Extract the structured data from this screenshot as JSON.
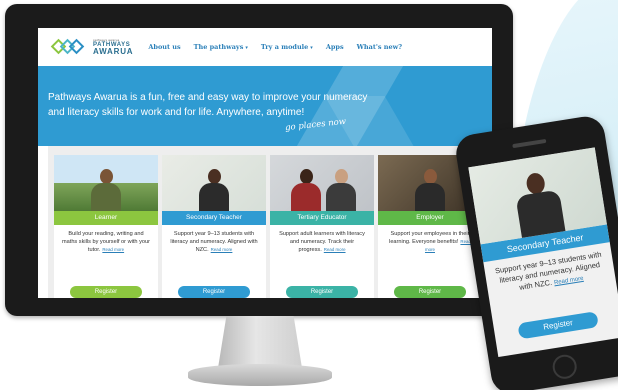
{
  "site": {
    "logo_tagline": "pathways awarua",
    "logo_title": "PATHWAYS",
    "logo_name": "AWARUA"
  },
  "nav": {
    "items": [
      {
        "label": "About us",
        "dropdown": false
      },
      {
        "label": "The pathways",
        "dropdown": true
      },
      {
        "label": "Try a module",
        "dropdown": true
      },
      {
        "label": "Apps",
        "dropdown": false
      },
      {
        "label": "What's new?",
        "dropdown": false
      }
    ],
    "caret": "▾"
  },
  "hero": {
    "text": "Pathways Awarua is a fun, free and easy way to improve your numeracy and literacy skills for work and for life. Anywhere, anytime!",
    "tagline": "go places now"
  },
  "cards": [
    {
      "label": "Learner",
      "description": "Build your reading, writing and maths skills by yourself or with your tutor.",
      "read_more": "Read more",
      "register": "Register",
      "color": "#8cc63f"
    },
    {
      "label": "Secondary Teacher",
      "description": "Support year 9–13 students with literacy and numeracy. Aligned with NZC.",
      "read_more": "Read more",
      "register": "Register",
      "color": "#2f9bd2"
    },
    {
      "label": "Tertiary Educator",
      "description": "Support adult learners with literacy and numeracy. Track their progress.",
      "read_more": "Read more",
      "register": "Register",
      "color": "#3bb3a6"
    },
    {
      "label": "Employer",
      "description": "Support your employees in their learning. Everyone benefits!",
      "read_more": "Read more",
      "register": "Register",
      "color": "#5fb848"
    }
  ],
  "phone": {
    "label": "Secondary Teacher",
    "description": "Support year 9–13 students with literacy and numeracy. Aligned with NZC.",
    "read_more": "Read more",
    "register": "Register"
  },
  "colors": {
    "brand_blue": "#2f9bd2",
    "nav_text": "#2a7fb8",
    "monitor_frame": "#1b1b1b"
  }
}
